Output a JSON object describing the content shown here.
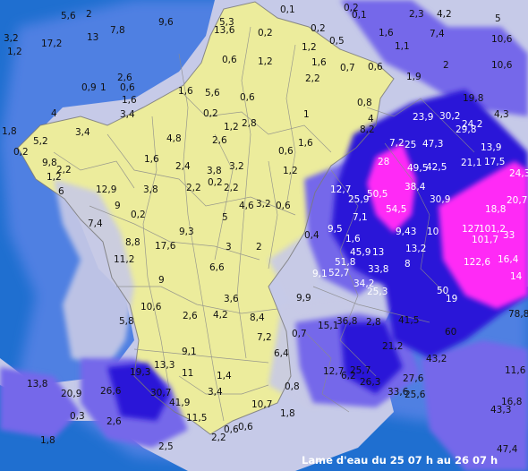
{
  "caption": "Lame d'eau du 25 07 h au 26 07 h",
  "colors": {
    "sea": "#1f6fd0",
    "dry": "#ecec9c",
    "light": "#c6cae8",
    "medium": "#6e63ea",
    "heavy": "#2a18d8",
    "extreme": "#ff2cf6",
    "border": "#8a8a8a"
  },
  "labels": {
    "l01": "5,6",
    "l02": "2",
    "l03": "9,6",
    "l04": "5,3",
    "l05": "0,1",
    "l06": "0,2",
    "l07": "0,1",
    "l08": "2,3",
    "l09": "4,2",
    "l10": "5",
    "l11": "3,2",
    "l12": "17,2",
    "l13": "13",
    "l14": "7,8",
    "l15": "1,2",
    "l16": "13,6",
    "l17": "0,2",
    "l18": "0,2",
    "l19": "0,5",
    "l20": "1,6",
    "l21": "7,4",
    "l22": "10,6",
    "l23": "1,2",
    "l24": "0,6",
    "l25": "2,6",
    "l26": "1,2",
    "l27": "1,6",
    "l28": "2,2",
    "l29": "0,9",
    "l30": "1",
    "l31": "0,6",
    "l32": "1,6",
    "l33": "5,6",
    "l34": "0,6",
    "l35": "1,6",
    "l36": "3,4",
    "l37": "0,2",
    "l38": "2,8",
    "l39": "1,2",
    "l40": "1",
    "l41": "4",
    "l42": "3,4",
    "l43": "1,8",
    "l44": "5,2",
    "l45": "0,2",
    "l46": "9,8",
    "l47": "2,2",
    "l48": "1,2",
    "l49": "6",
    "l50": "12,9",
    "l51": "3,8",
    "l52": "2,2",
    "l53": "2,4",
    "l54": "1,6",
    "l55": "2,6",
    "l56": "4,8",
    "l57": "3,8",
    "l58": "3,2",
    "l59": "2,2",
    "l60": "0,2",
    "l61": "4,6",
    "l62": "3,2",
    "l63": "0,6",
    "l64": "1,2",
    "l65": "1,6",
    "l66": "0,6",
    "l67": "0,8",
    "l68": "7,4",
    "l69": "9",
    "l70": "0,2",
    "l71": "9,3",
    "l72": "5",
    "l73": "6,6",
    "l74": "3",
    "l75": "2",
    "l76": "8,8",
    "l77": "17,6",
    "l78": "11,2",
    "l79": "9",
    "l80": "10,6",
    "l81": "2,6",
    "l82": "3,6",
    "l83": "8,4",
    "l84": "7,2",
    "l85": "9,9",
    "l86": "15,1",
    "l87": "36,8",
    "l88": "2,8",
    "l89": "21,2",
    "l90": "41,5",
    "l91": "5,8",
    "l92": "4,2",
    "l93": "9,1",
    "l94": "13,3",
    "l95": "1,4",
    "l96": "19,3",
    "l97": "11",
    "l98": "13,8",
    "l99": "20,9",
    "l100": "26,6",
    "l101": "2,6",
    "l102": "30,7",
    "l103": "41,9",
    "l104": "3,4",
    "l105": "0,3",
    "l106": "1,8",
    "l107": "11,5",
    "l108": "0,6",
    "l109": "2,2",
    "l110": "2,5",
    "l111": "10,7",
    "l112": "1,8",
    "l113": "6,2",
    "l114": "12,7",
    "l115": "25,7",
    "l116": "26,3",
    "l117": "27,6",
    "l118": "33,6",
    "l119": "25,6",
    "l120": "43,2",
    "l121": "60",
    "l122": "78,8",
    "l123": "50",
    "l124": "19",
    "l125": "14",
    "l126": "16,4",
    "l127": "122,6",
    "l128": "127",
    "l129": "101,2",
    "l130": "33",
    "l131": "101,7",
    "l132": "12,7",
    "l133": "25,9",
    "l134": "50,5",
    "l135": "7,1",
    "l136": "9,5",
    "l137": "1,6",
    "l138": "45,9",
    "l139": "13",
    "l140": "33,8",
    "l141": "51,8",
    "l142": "52,7",
    "l143": "9,1",
    "l144": "34,2",
    "l145": "25,3",
    "l146": "13,2",
    "l147": "8",
    "l148": "23,9",
    "l149": "30,2",
    "l150": "24,2",
    "l151": "29,8",
    "l152": "4,3",
    "l153": "7,2",
    "l154": "25",
    "l155": "47,3",
    "l156": "13,9",
    "l157": "28",
    "l158": "49,5",
    "l159": "42,5",
    "l160": "21,1",
    "l161": "17,5",
    "l162": "24,3",
    "l163": "20,7",
    "l164": "54,5",
    "l165": "38,4",
    "l166": "30,9",
    "l167": "9,43",
    "l168": "10",
    "l169": "18,8",
    "l170": "19,8",
    "l171": "10,6",
    "l172": "11,6",
    "l173": "16,8",
    "l174": "43,3",
    "l175": "47,4",
    "l176": "0,4",
    "l177": "0,7",
    "l178": "0,6",
    "l179": "2",
    "l180": "1,1",
    "l181": "1,9",
    "l182": "0,8",
    "l183": "8,2",
    "l184": "0,7",
    "l185": "6,4",
    "l186": "0,6",
    "l187": "4"
  }
}
